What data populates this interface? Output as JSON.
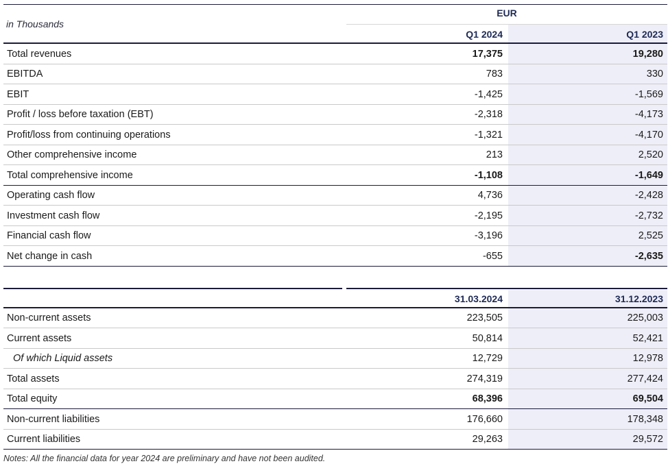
{
  "table1": {
    "units_label": "in Thousands",
    "currency_label": "EUR",
    "col1_header": "Q1 2024",
    "col2_header": "Q1 2023",
    "rows": [
      {
        "label": "Total revenues",
        "v1": "17,375",
        "v2": "19,280"
      },
      {
        "label": "EBITDA",
        "v1": "783",
        "v2": "330"
      },
      {
        "label": "EBIT",
        "v1": "-1,425",
        "v2": "-1,569"
      },
      {
        "label": "Profit / loss before taxation (EBT)",
        "v1": "-2,318",
        "v2": "-4,173"
      },
      {
        "label": "Profit/loss from continuing operations",
        "v1": "-1,321",
        "v2": "-4,170"
      },
      {
        "label": "Other comprehensive income",
        "v1": "213",
        "v2": "2,520"
      },
      {
        "label": "Total comprehensive income",
        "v1": "-1,108",
        "v2": "-1,649"
      },
      {
        "label": "Operating cash flow",
        "v1": "4,736",
        "v2": "-2,428"
      },
      {
        "label": "Investment cash flow",
        "v1": "-2,195",
        "v2": "-2,732"
      },
      {
        "label": "Financial cash flow",
        "v1": "-3,196",
        "v2": "2,525"
      },
      {
        "label": "Net change in cash",
        "v1": "-655",
        "v2": "-2,635"
      }
    ]
  },
  "table2": {
    "col1_header": "31.03.2024",
    "col2_header": "31.12.2023",
    "rows": [
      {
        "label": "Non-current assets",
        "v1": "223,505",
        "v2": "225,003"
      },
      {
        "label": "Current assets",
        "v1": "50,814",
        "v2": "52,421"
      },
      {
        "label": "Of which Liquid assets",
        "v1": "12,729",
        "v2": "12,978"
      },
      {
        "label": "Total assets",
        "v1": "274,319",
        "v2": "277,424"
      },
      {
        "label": "Total equity",
        "v1": "68,396",
        "v2": "69,504"
      },
      {
        "label": "Non-current liabilities",
        "v1": "176,660",
        "v2": "178,348"
      },
      {
        "label": "Current liabilities",
        "v1": "29,263",
        "v2": "29,572"
      }
    ]
  },
  "notes": "Notes: All the financial data for year 2024 are preliminary and have not been audited."
}
